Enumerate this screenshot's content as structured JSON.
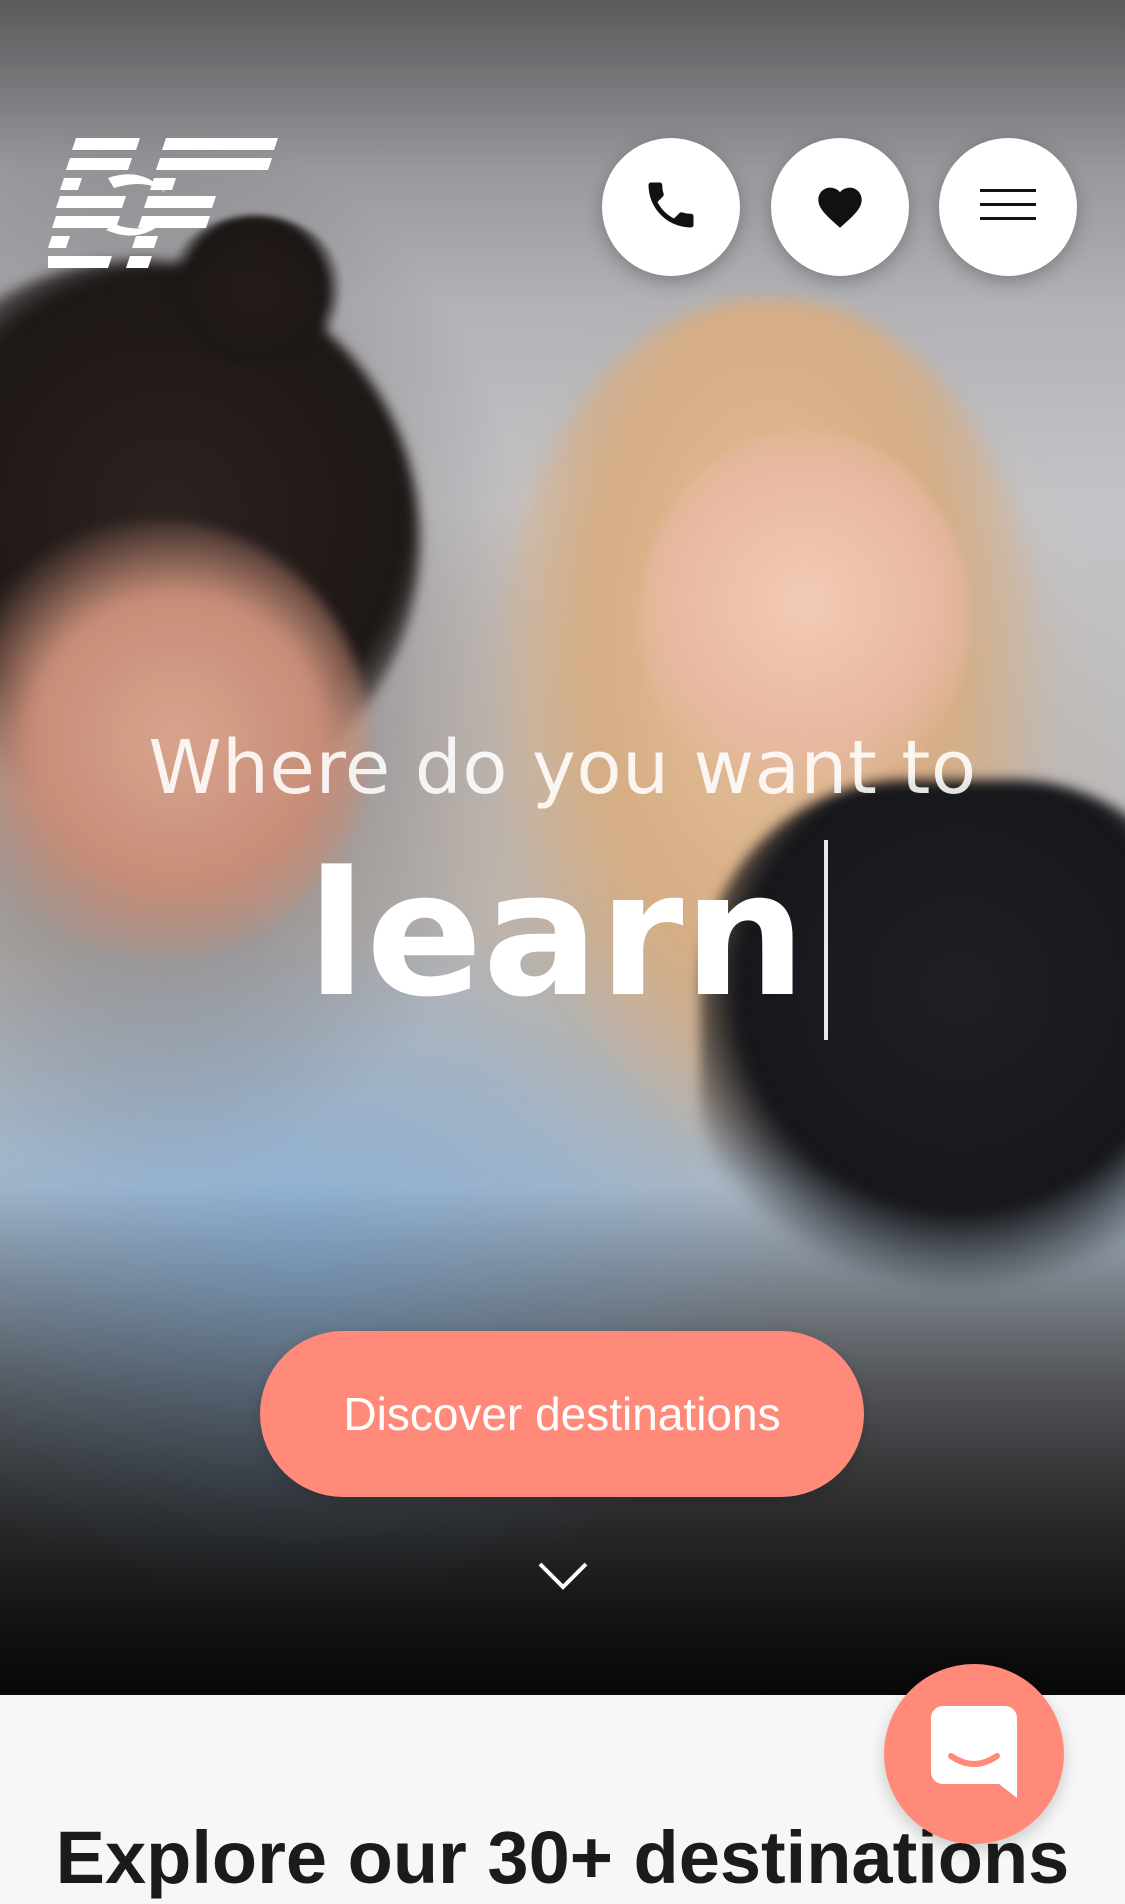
{
  "brand": {
    "logo_text": "EF",
    "accent_color": "#ff8a7a"
  },
  "header": {
    "buttons": [
      {
        "icon": "phone-icon"
      },
      {
        "icon": "heart-icon"
      },
      {
        "icon": "hamburger-menu-icon"
      }
    ]
  },
  "hero": {
    "headline": "Where do you want to",
    "typed_word": "learn",
    "cta_label": "Discover destinations",
    "scroll_icon": "chevron-down-icon"
  },
  "section": {
    "title": "Explore our 30+ destinations"
  },
  "chat": {
    "icon": "chat-bubble-icon"
  }
}
